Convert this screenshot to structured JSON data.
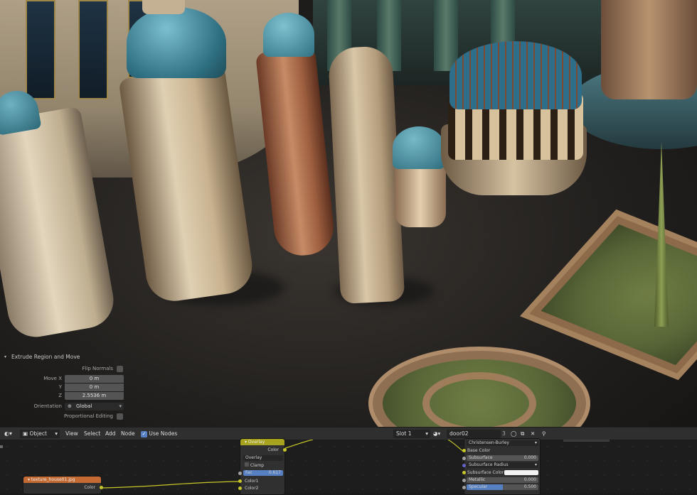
{
  "operator_panel": {
    "title": "Extrude Region and Move",
    "flip_normals_label": "Flip Normals",
    "move_x_label": "Move X",
    "move_x_value": "0 m",
    "y_label": "Y",
    "y_value": "0 m",
    "z_label": "Z",
    "z_value": "2.5536 m",
    "orientation_label": "Orientation",
    "orientation_value": "Global",
    "proportional_editing_label": "Proportional Editing"
  },
  "node_header": {
    "mode_label": "Object",
    "menu_view": "View",
    "menu_select": "Select",
    "menu_add": "Add",
    "menu_node": "Node",
    "use_nodes_label": "Use Nodes",
    "slot_label": "Slot 1",
    "material_name": "door02",
    "user_count": "3"
  },
  "nodes": {
    "image_node_title": "texture_house01.jpg",
    "image_node_output": "Color",
    "mix_node_title": "Overlay",
    "mix_node_output": "Color",
    "mix_blend_mode": "Overlay",
    "mix_clamp_label": "Clamp",
    "mix_fac_label": "Fac",
    "mix_fac_value": "0.617",
    "mix_color1_label": "Color1",
    "mix_color2_label": "Color2",
    "bsdf_method": "Christensen-Burley",
    "bsdf_base_color": "Base Color",
    "bsdf_subsurface_label": "Subsurface",
    "bsdf_subsurface_value": "0.000",
    "bsdf_subsurface_radius": "Subsurface Radius",
    "bsdf_subsurface_color": "Subsurface Color",
    "bsdf_metallic_label": "Metallic",
    "bsdf_metallic_value": "0.000",
    "bsdf_specular_label": "Specular",
    "bsdf_specular_value": "0.500"
  },
  "colors": {
    "accent_blue": "#5680c2",
    "image_node_header": "#c46a33",
    "mix_node_header": "#a8a31f",
    "socket_yellow": "#c7c729",
    "socket_grey": "#a1a1a1",
    "socket_purple": "#6363c7"
  },
  "icons": {
    "editor_type": "node-editor-icon",
    "mode": "object-mode-icon",
    "use_nodes": "checkbox-checked-icon",
    "material": "material-sphere-icon",
    "orientation": "global-orientation-icon",
    "pin": "pin-icon"
  }
}
